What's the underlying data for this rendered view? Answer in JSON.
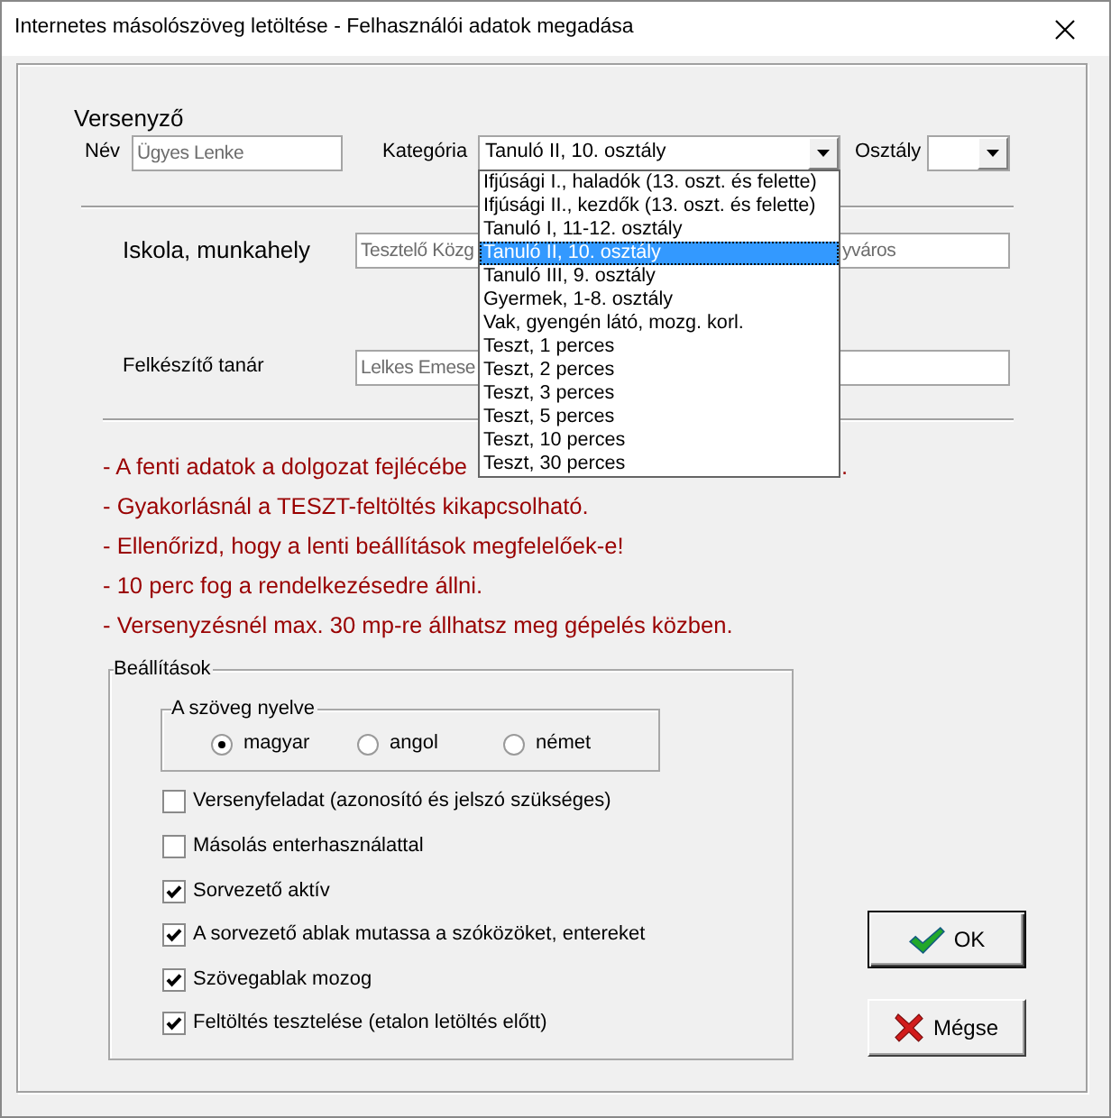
{
  "window": {
    "title": "Internetes másolószöveg letöltése - Felhasználói adatok megadása"
  },
  "competitor": {
    "heading": "Versenyző",
    "name": {
      "label": "Név",
      "value": "Ügyes Lenke"
    },
    "category": {
      "label": "Kategória",
      "value": "Tanuló II, 10. osztály",
      "expanded": true,
      "options": [
        {
          "label": "Ifjúsági I., haladók (13. oszt. és felette)",
          "selected": false
        },
        {
          "label": "Ifjúsági II., kezdők (13. oszt. és felette)",
          "selected": false
        },
        {
          "label": "Tanuló I, 11-12. osztály",
          "selected": false
        },
        {
          "label": "Tanuló II, 10. osztály",
          "selected": true
        },
        {
          "label": "Tanuló III, 9. osztály",
          "selected": false
        },
        {
          "label": "Gyermek, 1-8. osztály",
          "selected": false
        },
        {
          "label": "Vak, gyengén látó, mozg. korl.",
          "selected": false
        },
        {
          "label": "Teszt, 1 perces",
          "selected": false
        },
        {
          "label": "Teszt, 2 perces",
          "selected": false
        },
        {
          "label": "Teszt, 3 perces",
          "selected": false
        },
        {
          "label": "Teszt, 5 perces",
          "selected": false
        },
        {
          "label": "Teszt, 10 perces",
          "selected": false
        },
        {
          "label": "Teszt, 30 perces",
          "selected": false
        }
      ]
    },
    "class": {
      "label": "Osztály"
    }
  },
  "school": {
    "label": "Iskola, munkahely",
    "value_start": "Tesztelő Közg",
    "value_end": "yváros"
  },
  "teacher": {
    "label": "Felkészítő tanár",
    "value": "Lelkes Emese"
  },
  "notes": [
    {
      "text": "- A fenti adatok a dolgozat fejlécébe",
      "tail": "."
    },
    {
      "text": "- Gyakorlásnál a TESZT-feltöltés kikapcsolható."
    },
    {
      "text": "- Ellenőrizd, hogy a lenti beállítások megfelelőek-e!"
    },
    {
      "text": "- 10 perc fog a rendelkezésedre állni."
    },
    {
      "text": "- Versenyzésnél max. 30 mp-re állhatsz meg gépelés közben."
    }
  ],
  "settings": {
    "title": "Beállítások",
    "language": {
      "title": "A szöveg nyelve",
      "options": [
        {
          "label": "magyar",
          "selected": true
        },
        {
          "label": "angol",
          "selected": false
        },
        {
          "label": "német",
          "selected": false
        }
      ]
    },
    "checkboxes": [
      {
        "label": "Versenyfeladat (azonosító és jelszó szükséges)",
        "checked": false
      },
      {
        "label": "Másolás enterhasználattal",
        "checked": false
      },
      {
        "label": "Sorvezető aktív",
        "checked": true
      },
      {
        "label": "A sorvezető ablak mutassa a szóközöket, entereket",
        "checked": true
      },
      {
        "label": "Szövegablak mozog",
        "checked": true
      },
      {
        "label": "Feltöltés tesztelése (etalon letöltés előtt)",
        "checked": true
      }
    ]
  },
  "buttons": [
    {
      "kind": "ok",
      "label": "OK",
      "default": true
    },
    {
      "kind": "cancel",
      "label": "Mégse",
      "default": false
    }
  ]
}
